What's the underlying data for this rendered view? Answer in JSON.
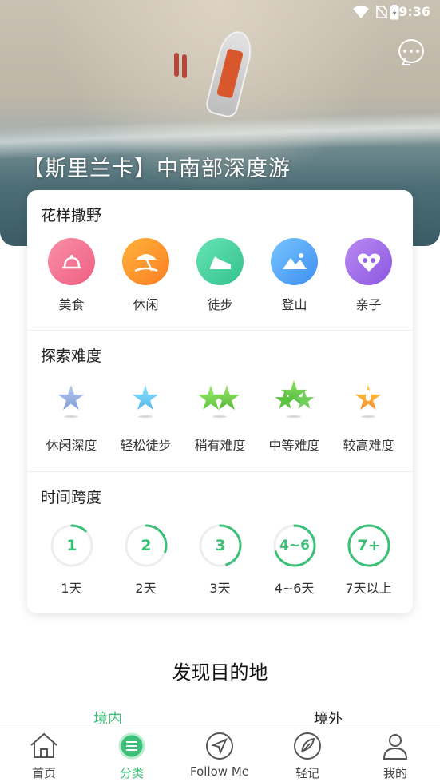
{
  "status_bar": {
    "time": "9:36"
  },
  "hero": {
    "title": "【斯里兰卡】中南部深度游"
  },
  "sections": [
    {
      "title": "花样撒野",
      "items": [
        {
          "label": "美食",
          "icon": "dining-icon",
          "color": "#f1678a"
        },
        {
          "label": "休闲",
          "icon": "beach-umbrella-icon",
          "color": "#fb8d2c"
        },
        {
          "label": "徒步",
          "icon": "sneaker-icon",
          "color": "#3fcf9a"
        },
        {
          "label": "登山",
          "icon": "mountain-icon",
          "color": "#4aa3f0"
        },
        {
          "label": "亲子",
          "icon": "family-heart-icon",
          "color": "#9b63e6"
        }
      ]
    },
    {
      "title": "探索难度",
      "items": [
        {
          "label": "休闲深度",
          "icon": "star-cool-icon",
          "color": "#8aa6d9"
        },
        {
          "label": "轻松徒步",
          "icon": "star-blue-icon",
          "color": "#5cc2ef"
        },
        {
          "label": "稍有难度",
          "icon": "double-star-green-icon",
          "color": "#6fd15a"
        },
        {
          "label": "中等难度",
          "icon": "triple-star-green-icon",
          "color": "#58c24a"
        },
        {
          "label": "较高难度",
          "icon": "star-alert-icon",
          "color": "#f7a33a"
        }
      ]
    },
    {
      "title": "时间跨度",
      "items": [
        {
          "label": "1天",
          "badge": "1",
          "progress": 0.12
        },
        {
          "label": "2天",
          "badge": "2",
          "progress": 0.3
        },
        {
          "label": "3天",
          "badge": "3",
          "progress": 0.45
        },
        {
          "label": "4~6天",
          "badge": "4~6",
          "progress": 0.7
        },
        {
          "label": "7天以上",
          "badge": "7+",
          "progress": 1.0
        }
      ]
    }
  ],
  "discover": {
    "title": "发现目的地",
    "tabs": [
      {
        "label": "境内",
        "active": true
      },
      {
        "label": "境外",
        "active": false
      }
    ]
  },
  "bottom_nav": [
    {
      "label": "首页",
      "icon": "home-icon",
      "active": false
    },
    {
      "label": "分类",
      "icon": "category-icon",
      "active": true
    },
    {
      "label": "Follow Me",
      "icon": "navigation-icon",
      "active": false
    },
    {
      "label": "轻记",
      "icon": "feather-icon",
      "active": false
    },
    {
      "label": "我的",
      "icon": "user-icon",
      "active": false
    }
  ],
  "colors": {
    "accent": "#3cbf77",
    "ring_track": "#eeeeee"
  }
}
